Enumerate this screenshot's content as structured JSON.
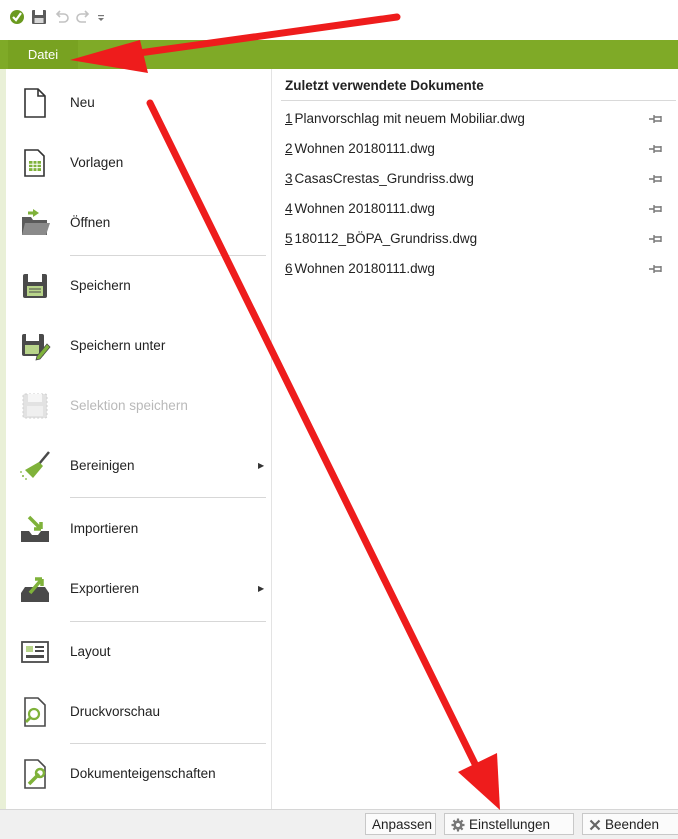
{
  "quick_access": {
    "icons": [
      "green-check-icon",
      "save-icon",
      "undo-icon",
      "redo-icon",
      "customize-dropdown-icon"
    ]
  },
  "titlebar": {
    "active_tab": "Datei",
    "color": "#7faa27"
  },
  "menu": {
    "items": [
      {
        "label": "Neu",
        "icon": "new-document-icon"
      },
      {
        "label": "Vorlagen",
        "icon": "templates-icon"
      },
      {
        "label": "Öffnen",
        "icon": "open-folder-icon"
      },
      {
        "label": "Speichern",
        "icon": "save-icon"
      },
      {
        "label": "Speichern unter",
        "icon": "save-as-icon"
      },
      {
        "label": "Selektion speichern",
        "icon": "save-selection-icon",
        "disabled": true
      },
      {
        "label": "Bereinigen",
        "icon": "broom-icon",
        "submenu": true
      },
      {
        "label": "Importieren",
        "icon": "import-icon"
      },
      {
        "label": "Exportieren",
        "icon": "export-icon",
        "submenu": true
      },
      {
        "label": "Layout",
        "icon": "layout-icon"
      },
      {
        "label": "Druckvorschau",
        "icon": "print-preview-icon"
      },
      {
        "label": "Dokumenteigenschaften",
        "icon": "document-properties-icon"
      }
    ]
  },
  "recent": {
    "title": "Zuletzt verwendete Dokumente",
    "docs": [
      {
        "num": "1",
        "name": "Planvorschlag mit neuem Mobiliar.dwg"
      },
      {
        "num": "2",
        "name": "Wohnen 20180111.dwg"
      },
      {
        "num": "3",
        "name": "CasasCrestas_Grundriss.dwg"
      },
      {
        "num": "4",
        "name": "Wohnen 20180111.dwg"
      },
      {
        "num": "5",
        "name": "180112_BÖPA_Grundriss.dwg"
      },
      {
        "num": "6",
        "name": "Wohnen 20180111.dwg"
      }
    ]
  },
  "footer": {
    "customize_label": "Anpassen",
    "settings_label": "Einstellungen",
    "exit_label": "Beenden"
  },
  "colors": {
    "accent": "#7faa27",
    "annotation": "#ee1c1c"
  }
}
